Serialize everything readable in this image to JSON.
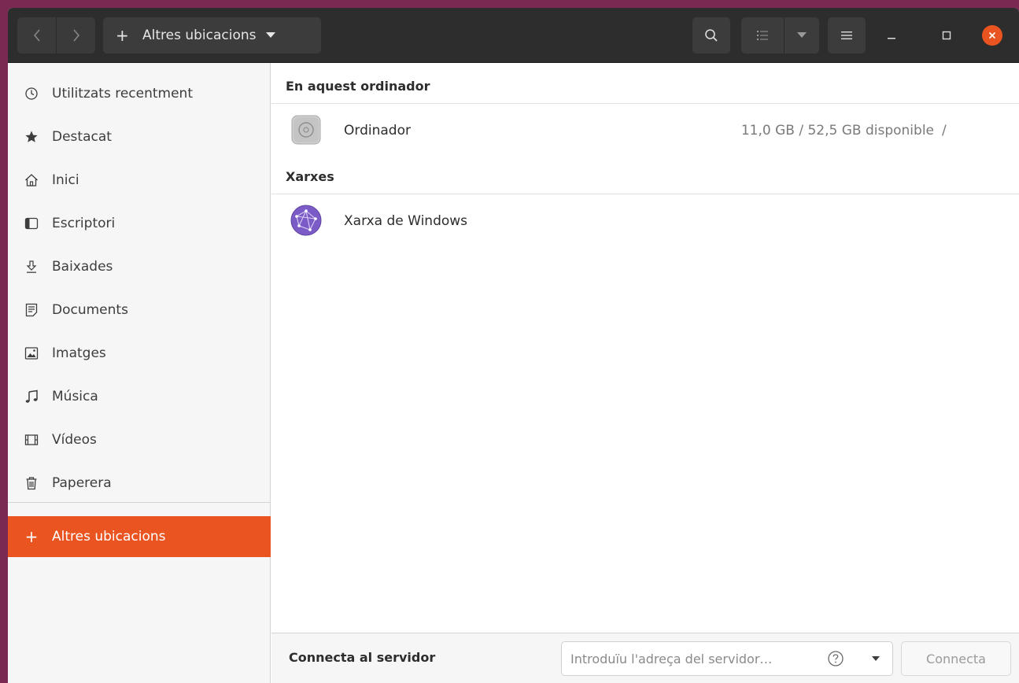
{
  "header": {
    "path_label": "Altres ubicacions",
    "icons": {
      "back": "go-back-icon",
      "forward": "go-forward-icon",
      "plus": "plus-icon",
      "search": "search-icon",
      "view": "list-view-icon",
      "menu": "hamburger-menu-icon",
      "minimize": "minimize-icon",
      "maximize": "maximize-icon",
      "close": "close-icon"
    }
  },
  "sidebar": {
    "items": [
      {
        "label": "Utilitzats recentment",
        "icon": "recent-icon"
      },
      {
        "label": "Destacat",
        "icon": "star-icon"
      },
      {
        "label": "Inici",
        "icon": "home-icon"
      },
      {
        "label": "Escriptori",
        "icon": "desktop-icon"
      },
      {
        "label": "Baixades",
        "icon": "download-icon"
      },
      {
        "label": "Documents",
        "icon": "document-icon"
      },
      {
        "label": "Imatges",
        "icon": "image-icon"
      },
      {
        "label": "Música",
        "icon": "music-icon"
      },
      {
        "label": "Vídeos",
        "icon": "video-icon"
      },
      {
        "label": "Paperera",
        "icon": "trash-icon"
      }
    ],
    "other_locations": {
      "label": "Altres ubicacions",
      "icon": "plus-icon",
      "active": true
    }
  },
  "main": {
    "sections": [
      {
        "title": "En aquest ordinador",
        "rows": [
          {
            "name": "Ordinador",
            "info": "11,0 GB / 52,5 GB disponible",
            "path": "/",
            "icon": "drive-icon"
          }
        ]
      },
      {
        "title": "Xarxes",
        "rows": [
          {
            "name": "Xarxa de Windows",
            "icon": "network-icon"
          }
        ]
      }
    ]
  },
  "bottom": {
    "label": "Connecta al servidor",
    "input_placeholder": "Introduïu l'adreça del servidor…",
    "input_value": "",
    "connect_label": "Connecta"
  },
  "colors": {
    "accent": "#e95420",
    "headerbar": "#2d2d2d",
    "sidebar_bg": "#f6f6f6",
    "network_icon": "#7b5cc6"
  }
}
